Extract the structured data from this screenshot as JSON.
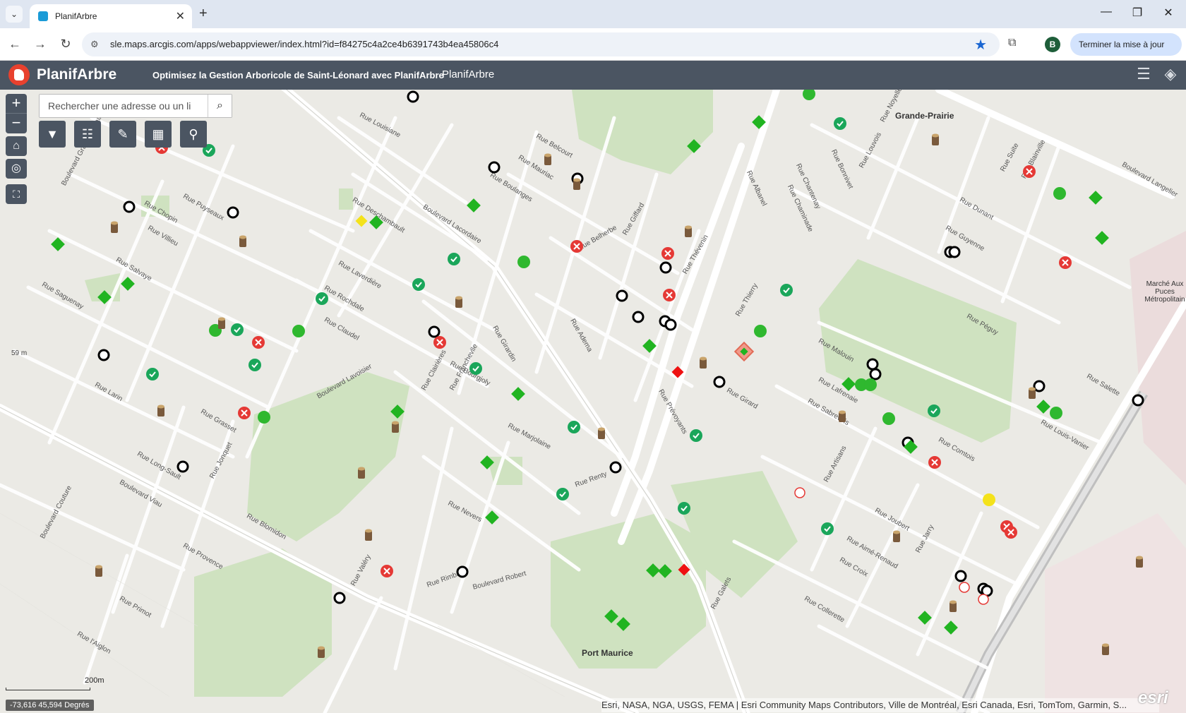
{
  "browser": {
    "tab_title": "PlanifArbre",
    "url": "sle.maps.arcgis.com/apps/webappviewer/index.html?id=f84275c4a2ce4b6391743b4ea45806c4",
    "profile_initial": "B",
    "update_button": "Terminer la mise à jour"
  },
  "app": {
    "name": "PlanifArbre",
    "subtitle": "Optimisez la Gestion Arboricole de Saint-Léonard avec PlanifArbre",
    "link": "PlanifArbre"
  },
  "search": {
    "placeholder": "Rechercher une adresse ou un li"
  },
  "map": {
    "coordinates": "-73,616 45,594 Degrés",
    "scale_label": "200m",
    "elevation": "59 m",
    "attribution": "Esri, NASA, NGA, USGS, FEMA | Esri Community Maps Contributors, Ville de Montréal, Esri Canada, Esri, TomTom, Garmin, S...",
    "powered_by": "esri",
    "places": {
      "grande_prairie": "Grande-Prairie",
      "marche": "Marché Aux Puces Métropolitain",
      "port_maurice": "Port Maurice"
    },
    "streets": [
      "Rue Louisiane",
      "Rue Belcourt",
      "Rue Boulanges",
      "Rue Mauriac",
      "Boulevard Lacordaire",
      "Rue Deschambault",
      "Rue Puyseaux",
      "Rue Villieu",
      "Rue Chopin",
      "Rue Salvaye",
      "Rue Saguenay",
      "Boulevard Grandes-Prairies",
      "Rue Laverdière",
      "Rue Rochdale",
      "Rue Claudel",
      "Rue Bourgjoly",
      "Rue Girardin",
      "Boulevard Lavoisier",
      "Rue Clairières",
      "Rue Franchevlle",
      "Rue Marjolaine",
      "Rue Grasset",
      "Rue Larin",
      "Rue Jonquet",
      "Rue Long-Sault",
      "Boulevard Viau",
      "Rue Blomidon",
      "Rue Provence",
      "Rue Primot",
      "Rue l'Aiglon",
      "Boulevard Couture",
      "Rue Valéry",
      "Rue Rimbaud",
      "Boulevard Robert",
      "Rue Nevers",
      "Rue Renty",
      "Rue Adema",
      "Rue Belherbe",
      "Rue Giffard",
      "Rue Thévenin",
      "Rue Thierry",
      "Rue Girard",
      "Rue Prévoyants",
      "Rue Albanel",
      "Rue Chaminade",
      "Rue Chantenay",
      "Rue Bonnivet",
      "Rue Louvois",
      "Rue Noyelles",
      "Rue Dunant",
      "Rue Guyenne",
      "Rue Péguy",
      "Rue Malouin",
      "Rue Lafrenaie",
      "Rue Sabrevois",
      "Rue Comtois",
      "Rue Joubert",
      "Rue Aimé-Renaud",
      "Rue Croix",
      "Rue Collerette",
      "Rue Jarry",
      "Rue Salette",
      "Rue Louis-Vanier",
      "Rue Blainville",
      "Rue Suite",
      "Boulevard Langelier",
      "Rue Galets",
      "Rue Artisans"
    ]
  },
  "legend": {
    "planted_circle": "#2fb82f",
    "planting_diamond": "#21b421",
    "validated_check": "#1aa65a",
    "removed_x": "#e53935",
    "candidate_ring": "#000000",
    "stump": "#7a5a3c",
    "yellow": "#f4e21a",
    "red_diamond": "#ee1111"
  }
}
